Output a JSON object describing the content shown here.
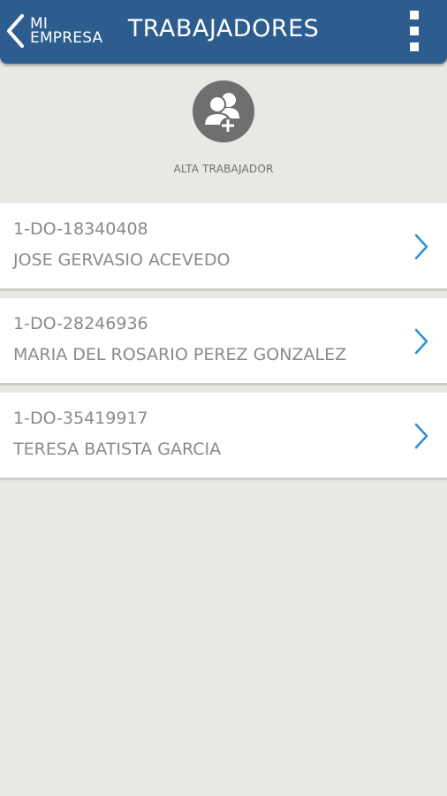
{
  "header": {
    "back_label_line1": "MI",
    "back_label_line2": "EMPRESA",
    "title": "TRABAJADORES",
    "back_icon": "chevron-left-icon",
    "menu_icon": "more-vertical-icon"
  },
  "add_worker": {
    "label": "ALTA TRABAJADOR",
    "icon": "add-users-icon"
  },
  "workers": [
    {
      "code": "1-DO-18340408",
      "name": "JOSE GERVASIO ACEVEDO"
    },
    {
      "code": "1-DO-28246936",
      "name": "MARIA DEL ROSARIO PEREZ GONZALEZ"
    },
    {
      "code": "1-DO-35419917",
      "name": "TERESA BATISTA GARCIA"
    }
  ],
  "colors": {
    "header_bg": "#2d5c8f",
    "page_bg": "#e9e8e4",
    "chevron": "#2a8fd8",
    "icon_gray": "#6f6f6f"
  }
}
